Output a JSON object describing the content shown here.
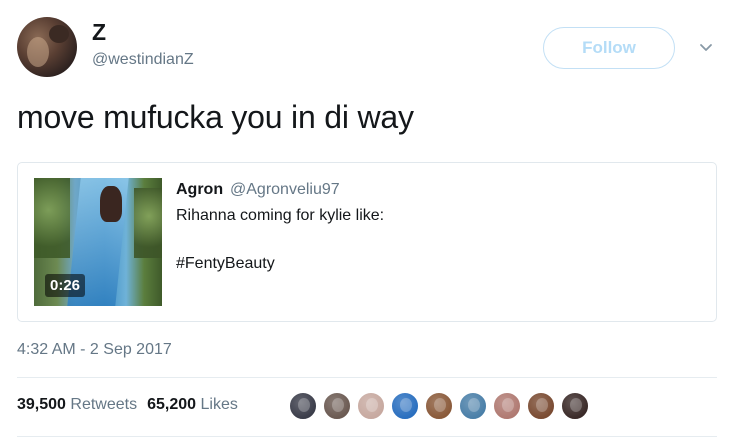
{
  "tweet": {
    "author_name": "Z",
    "author_handle": "@westindianZ",
    "follow_label": "Follow",
    "text": "move mufucka you in di way",
    "timestamp": "4:32 AM - 2 Sep 2017"
  },
  "quoted": {
    "author_name": "Agron",
    "author_handle": "@Agronveliu97",
    "line1": "Rihanna coming for kylie like:",
    "line2": "#FentyBeauty",
    "video_duration": "0:26"
  },
  "stats": {
    "retweets_count": "39,500",
    "retweets_label": "Retweets",
    "likes_count": "65,200",
    "likes_label": "Likes"
  },
  "likers": [
    {
      "color": "#3b3d4a"
    },
    {
      "color": "#6b5a52"
    },
    {
      "color": "#c7a9a0"
    },
    {
      "color": "#2a6fbf"
    },
    {
      "color": "#8a5a3a"
    },
    {
      "color": "#4a7fa8"
    },
    {
      "color": "#b07a72"
    },
    {
      "color": "#7a4b32"
    },
    {
      "color": "#3a2a28"
    }
  ],
  "colors": {
    "text_primary": "#14171a",
    "text_secondary": "#657786",
    "follow_accent": "#b4dcf7",
    "border": "#e1e8ed"
  }
}
